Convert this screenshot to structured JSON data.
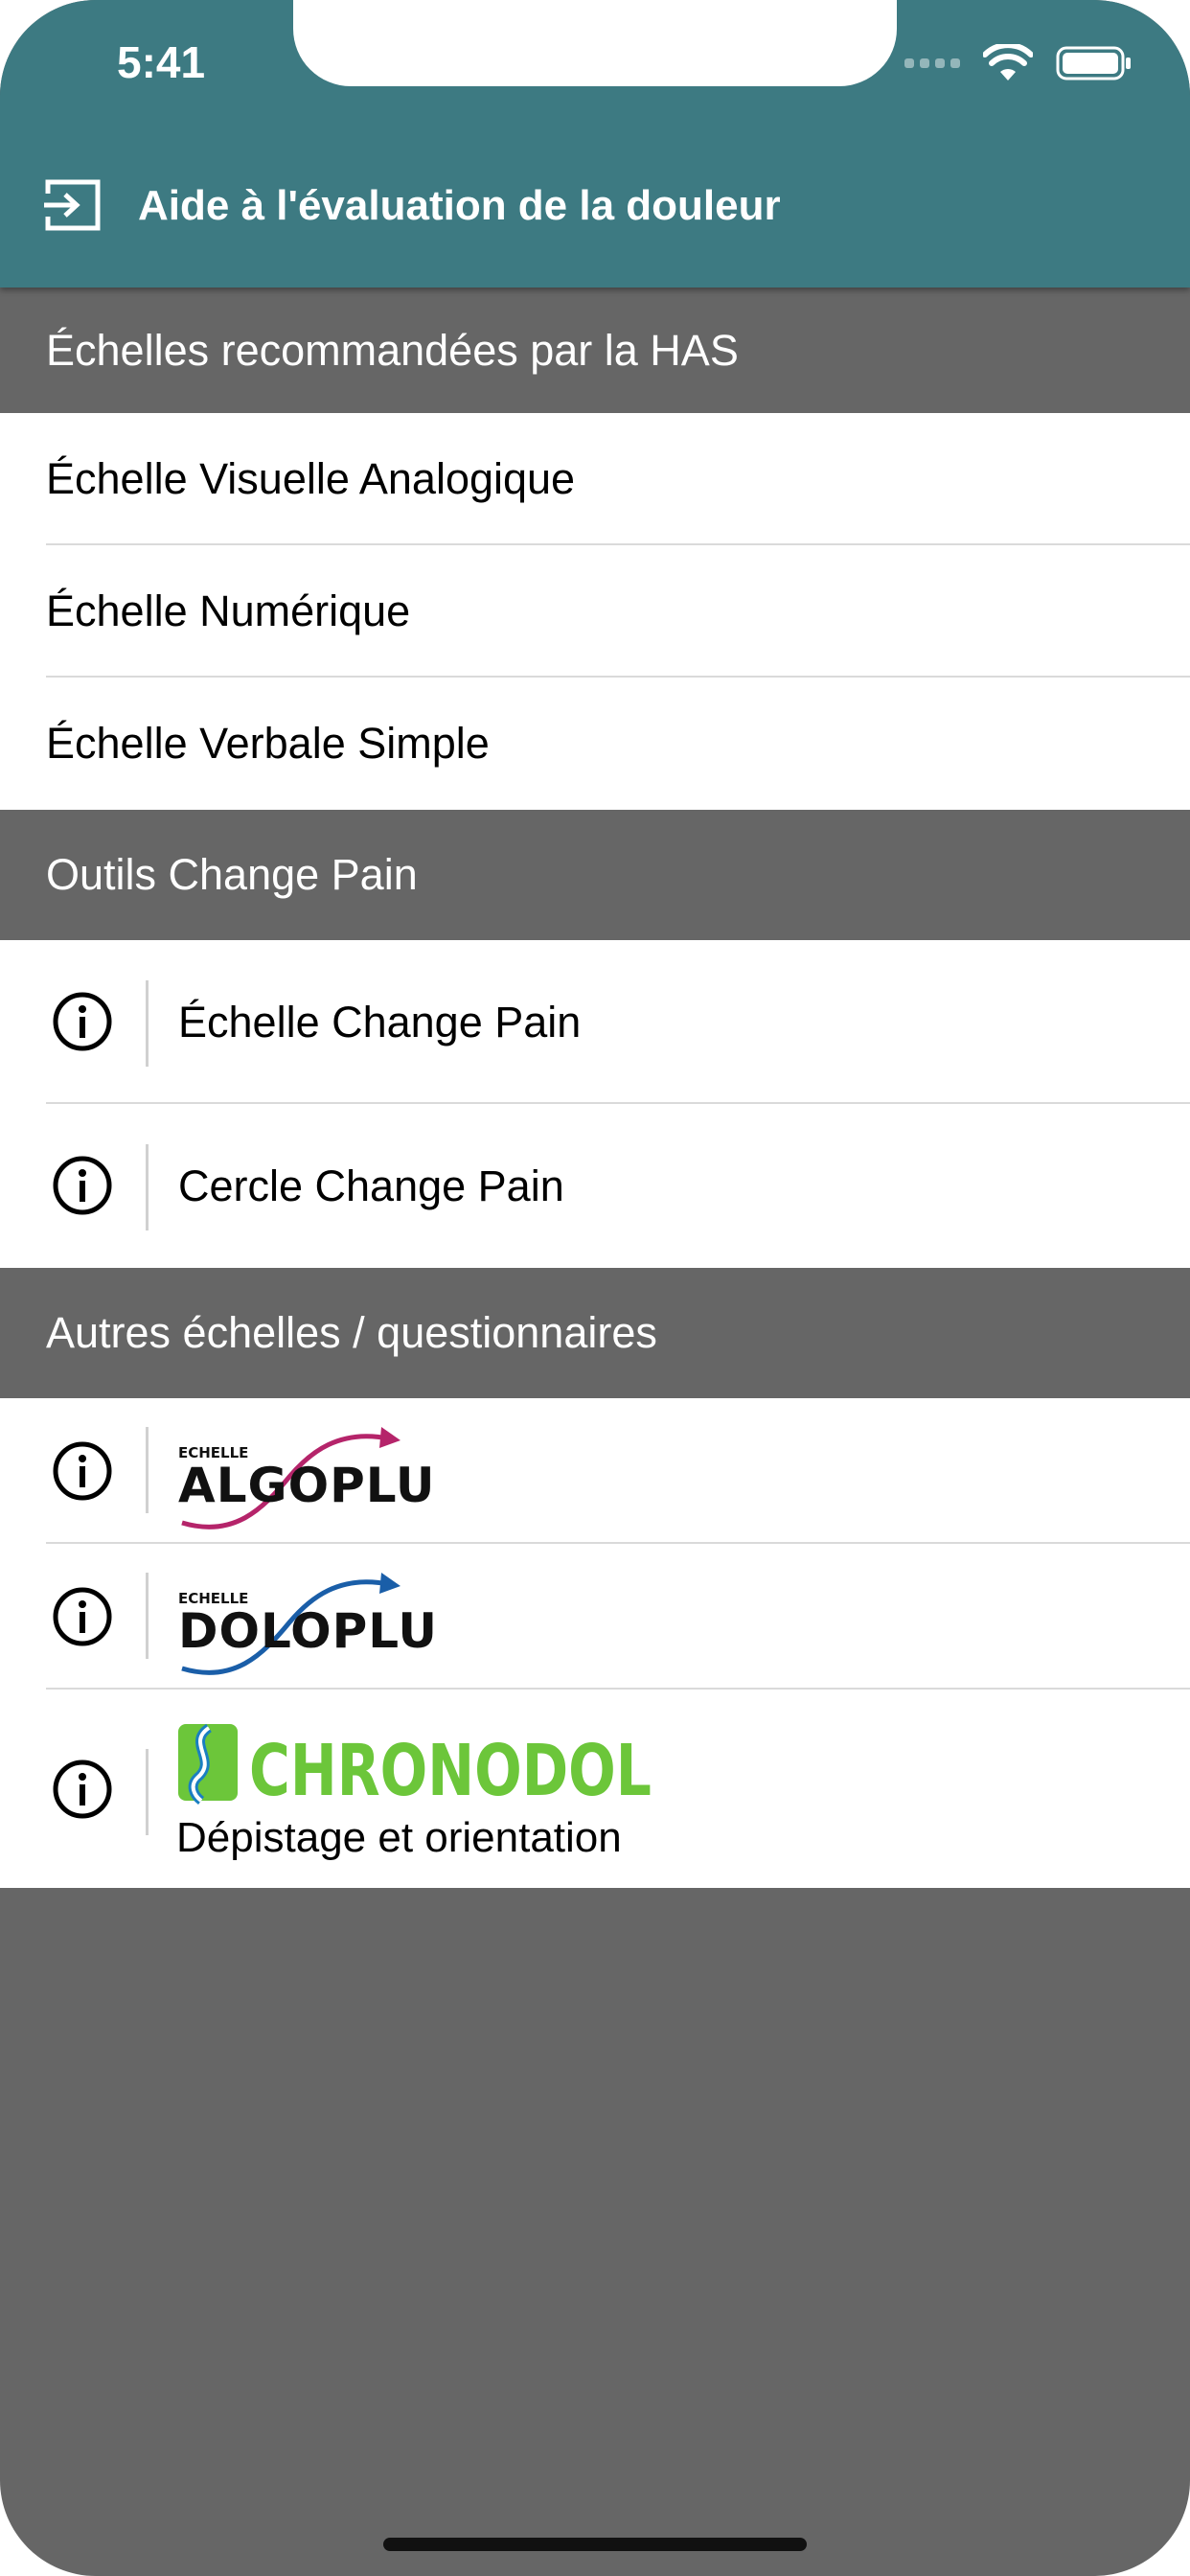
{
  "status_bar": {
    "time": "5:41"
  },
  "nav": {
    "title": "Aide à l'évaluation de la douleur",
    "icon": "exit-icon"
  },
  "sections": [
    {
      "header": "Échelles recommandées par la HAS",
      "items": [
        "Échelle Visuelle Analogique",
        "Échelle Numérique",
        "Échelle Verbale Simple"
      ]
    },
    {
      "header": "Outils Change Pain",
      "items": [
        "Échelle Change Pain",
        "Cercle Change Pain"
      ]
    },
    {
      "header": "Autres échelles / questionnaires",
      "items": [
        {
          "logo_small": "ECHELLE",
          "logo_main": "ALGOPLUS",
          "accent": "#b5246a"
        },
        {
          "logo_small": "ECHELLE",
          "logo_main": "DOLOPLUS",
          "accent": "#1a5ea8"
        },
        {
          "logo_main": "CHRONODOL",
          "subtitle": "Dépistage et orientation",
          "accent": "#6cc63a"
        }
      ]
    }
  ],
  "colors": {
    "header_bg": "#3d7a82",
    "section_bg": "#666666",
    "separator": "#dadada"
  }
}
